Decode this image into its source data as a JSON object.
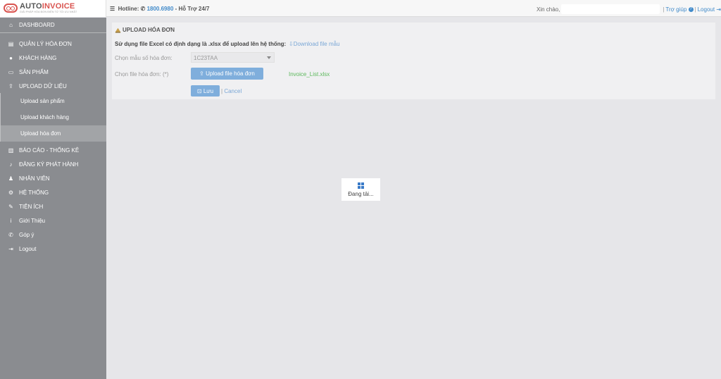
{
  "header": {
    "brand_part1": "AUTO",
    "brand_part2": "INVOICE",
    "tagline": "GIẢI PHÁP HÓA ĐƠN ĐIỆN TỬ TỐI ƯU NHẤT",
    "hotline_label": "Hotline:",
    "hotline_number": "1800.6980",
    "support": "- Hỗ Trợ 24/7",
    "greeting": "Xin chào,",
    "help": "Trợ giúp",
    "logout": "Logout"
  },
  "sidebar": {
    "items": [
      {
        "label": "DASHBOARD",
        "icon": "home-icon"
      },
      {
        "label": "QUẢN LÝ HÓA ĐƠN",
        "icon": "file-icon"
      },
      {
        "label": "KHÁCH HÀNG",
        "icon": "user-icon"
      },
      {
        "label": "SẢN PHẨM",
        "icon": "folder-icon"
      },
      {
        "label": "UPLOAD DỮ LIỆU",
        "icon": "upload-icon"
      },
      {
        "label": "BÁO CÁO - THỐNG KÊ",
        "icon": "chart-icon"
      },
      {
        "label": "ĐĂNG KÝ PHÁT HÀNH",
        "icon": "bell-icon"
      },
      {
        "label": "NHÂN VIÊN",
        "icon": "users-icon"
      },
      {
        "label": "HỆ THỐNG",
        "icon": "gears-icon"
      },
      {
        "label": "TIỆN ÍCH",
        "icon": "wrench-icon"
      },
      {
        "label": "Giới Thiệu",
        "icon": "info-icon"
      },
      {
        "label": "Góp ý",
        "icon": "phone-icon"
      },
      {
        "label": "Logout",
        "icon": "sign-out-icon"
      }
    ],
    "sub_items": [
      {
        "label": "Upload sản phẩm"
      },
      {
        "label": "Upload khách hàng"
      },
      {
        "label": "Upload hóa đơn"
      }
    ]
  },
  "panel": {
    "title": "UPLOAD HÓA ĐƠN",
    "description": "Sử dụng file Excel có định dạng là .xlsx để upload lên hệ thống:",
    "download_link": "Download file mẫu",
    "template_label": "Chọn mẫu số hóa đơn:",
    "template_value": "1C23TAA",
    "file_label": "Chọn file hóa đơn: (*)",
    "upload_button": "Upload file hóa đơn",
    "file_name": "Invoice_List.xlsx",
    "save_button": "Lưu",
    "cancel": "Cancel"
  },
  "loading": {
    "text": "Đang tải..."
  },
  "colors": {
    "accent": "#428bca",
    "sidebar": "#8a8c90",
    "brand_red": "#d9534f",
    "success": "#5cb85c"
  }
}
